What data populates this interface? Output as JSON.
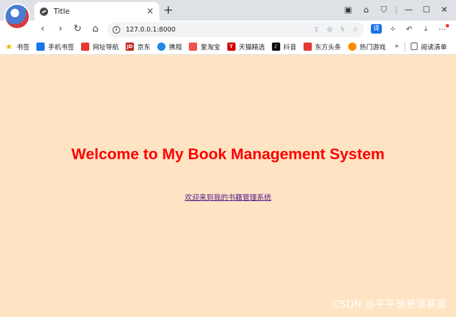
{
  "tab": {
    "title": "Title",
    "close_glyph": "×",
    "new_tab_glyph": "+"
  },
  "toolbar": {
    "url": "127.0.0.1:8000",
    "translate_label": "译"
  },
  "bookmarks": [
    {
      "label": "书签",
      "icon": "star-icon",
      "color": "#f4b400"
    },
    {
      "label": "手机书签",
      "icon": "phone-icon",
      "color": "#1a73e8"
    },
    {
      "label": "网址导航",
      "icon": "nav-icon",
      "color": "#e53935"
    },
    {
      "label": "京东",
      "icon": "jd-icon",
      "color": "#c62828"
    },
    {
      "label": "携程",
      "icon": "ctrip-icon",
      "color": "#1e88e5"
    },
    {
      "label": "爱淘宝",
      "icon": "taobao-icon",
      "color": "#ef5350"
    },
    {
      "label": "天猫精选",
      "icon": "tmall-icon",
      "color": "#d50000"
    },
    {
      "label": "抖音",
      "icon": "douyin-icon",
      "color": "#111111"
    },
    {
      "label": "东方头条",
      "icon": "toutiao-icon",
      "color": "#e53935"
    },
    {
      "label": "热门游戏",
      "icon": "game-icon",
      "color": "#fb8c00"
    }
  ],
  "bookmarks_more": "»",
  "reading_list": "阅读清单",
  "page": {
    "heading": "Welcome to My Book Management System",
    "link_text": "欢迎来到我的书籍管理系统",
    "background": "#ffe4c4",
    "heading_color": "#ff0000"
  },
  "watermark": "CSDN @平平爸爸请暴富"
}
